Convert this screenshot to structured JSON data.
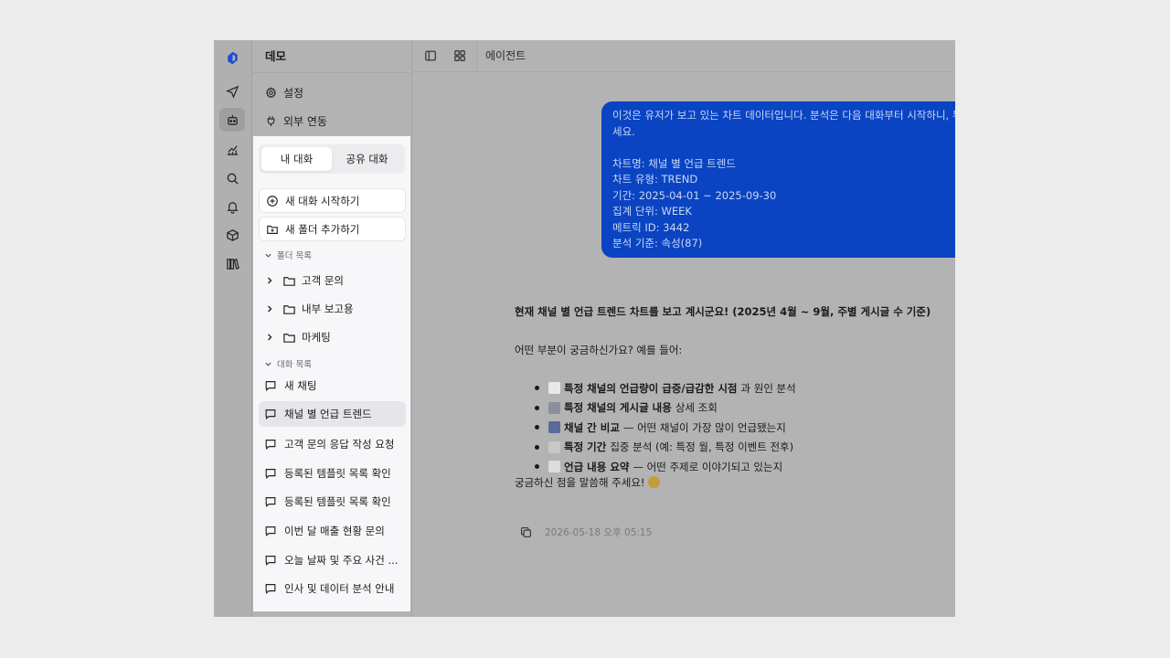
{
  "sidebar": {
    "title": "데모",
    "settings": "설정",
    "integrations": "외부 연동",
    "tabs": [
      "내 대화",
      "공유 대화"
    ],
    "new_chat": "새 대화 시작하기",
    "new_folder": "새 폴더 추가하기",
    "folders_header": "폴더 목록",
    "folders": [
      "고객 문의",
      "내부 보고용",
      "마케팅"
    ],
    "chats_header": "대화 목록",
    "chats": [
      "새 채팅",
      "채널 별 언급 트렌드",
      "고객 문의 응답 작성 요청",
      "등록된 템플릿 목록 확인",
      "등록된 템플릿 목록 확인",
      "이번 달 매출 현황 문의",
      "오늘 날짜 및 주요 사건 ...",
      "인사 및 데이터 분석 안내"
    ],
    "active_chat_index": 1
  },
  "rail_icons": [
    "logo-icon",
    "send-icon",
    "bot-icon",
    "chart-icon",
    "search-icon",
    "bell-icon",
    "cube-icon",
    "library-icon"
  ],
  "header": {
    "title": "에이전트"
  },
  "user_message": {
    "lines": [
      "이것은 유저가 보고 있는 차트 데이터입니다. 분석은 다음 대화부터 시작하니, 무",
      "세요.",
      "",
      "차트명: 채널 별 언급 트렌드",
      "차트 유형: TREND",
      "기간: 2025-04-01 ~ 2025-09-30",
      "집계 단위: WEEK",
      "메트릭 ID: 3442",
      "분석 기준: 속성(87)"
    ]
  },
  "assistant": {
    "intro": "현재 채널 별 언급 트렌드 차트를 보고 계시군요! (2025년 4월 ~ 9월, 주별 게시글 수 기준)",
    "question": "어떤 부분이 궁금하신가요? 예를 들어:",
    "bullets": [
      {
        "bold": "특정 채널의 언급량이 급증/급감한 시점",
        "rest": "과 원인 분석",
        "icon": "chart-up-emoji",
        "color": "#e9e9ec"
      },
      {
        "bold": "특정 채널의 게시글 내용",
        "rest": "상세 조회",
        "icon": "magnifier-emoji",
        "color": "#8a8f99"
      },
      {
        "bold": "채널 간 비교",
        "rest": "— 어떤 채널이 가장 많이 언급됐는지",
        "icon": "bar-chart-emoji",
        "color": "#5a6a9a"
      },
      {
        "bold": "특정 기간",
        "rest": "집중 분석 (예: 특정 월, 특정 이벤트 전후)",
        "icon": "calendar-emoji",
        "color": "#c7c7c7"
      },
      {
        "bold": "언급 내용 요약",
        "rest": "— 어떤 주제로 이야기되고 있는지",
        "icon": "speech-emoji",
        "color": "#dcdce0"
      }
    ],
    "closing": "궁금하신 점을 말씀해 주세요!",
    "timestamp": "2026-05-18 오후 05:15"
  }
}
